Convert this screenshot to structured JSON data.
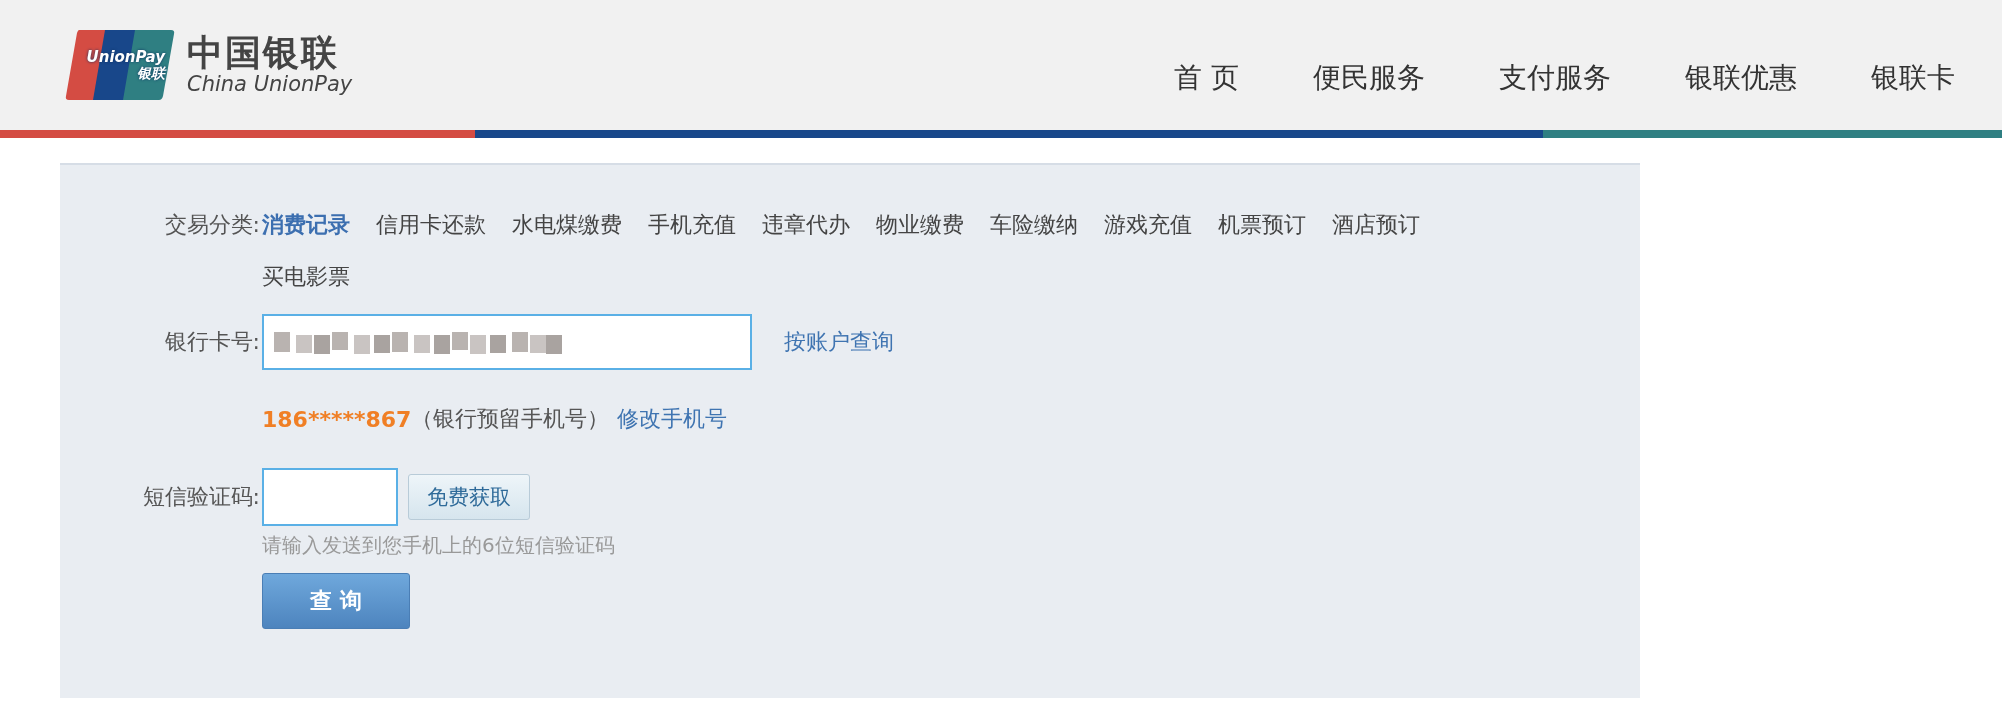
{
  "logo": {
    "card_text": "UnionPay",
    "card_subtext": "银联",
    "name_cn": "中国银联",
    "name_en": "China UnionPay"
  },
  "nav": [
    {
      "label": "首 页"
    },
    {
      "label": "便民服务"
    },
    {
      "label": "支付服务"
    },
    {
      "label": "银联优惠"
    },
    {
      "label": "银联卡"
    }
  ],
  "form": {
    "category_label": "交易分类:",
    "categories": [
      {
        "label": "消费记录",
        "selected": true
      },
      {
        "label": "信用卡还款",
        "selected": false
      },
      {
        "label": "水电煤缴费",
        "selected": false
      },
      {
        "label": "手机充值",
        "selected": false
      },
      {
        "label": "违章代办",
        "selected": false
      },
      {
        "label": "物业缴费",
        "selected": false
      },
      {
        "label": "车险缴纳",
        "selected": false
      },
      {
        "label": "游戏充值",
        "selected": false
      },
      {
        "label": "机票预订",
        "selected": false
      },
      {
        "label": "酒店预订",
        "selected": false
      },
      {
        "label": "买电影票",
        "selected": false
      }
    ],
    "card_label": "银行卡号:",
    "account_link": "按账户查询",
    "phone": "186*****867",
    "phone_note": "（银行预留手机号）",
    "change_phone_link": "修改手机号",
    "sms_label": "短信验证码:",
    "sms_button": "免费获取",
    "sms_hint": "请输入发送到您手机上的6位短信验证码",
    "submit": "查 询"
  }
}
